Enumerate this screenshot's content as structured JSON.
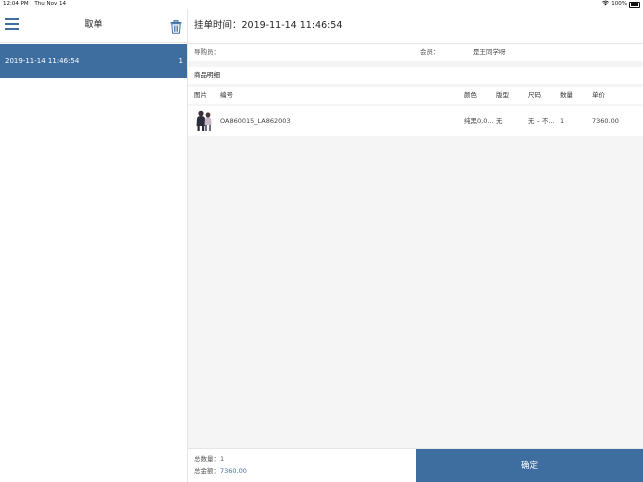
{
  "status_bar": {
    "time": "12:04 PM",
    "date": "Thu Nov 14",
    "battery": "100%"
  },
  "left_panel": {
    "title": "取单",
    "orders": [
      {
        "time": "2019-11-14 11:46:54",
        "count": "1"
      }
    ]
  },
  "detail": {
    "title": "挂单时间：2019-11-14 11:46:54",
    "guide_label": "导购员：",
    "guide_value": "",
    "member_label": "会员：",
    "member_value": "是王同学呀",
    "section_title": "商品明细",
    "columns": {
      "image": "图片",
      "code": "编号",
      "color": "颜色",
      "style": "版型",
      "size": "尺码",
      "qty": "数量",
      "price": "单价"
    },
    "items": [
      {
        "code": "OA860015_LA862003",
        "color": "纯黑0,0...",
        "style": "无",
        "size": "无 – 不...",
        "qty": "1",
        "price": "7360.00"
      }
    ]
  },
  "footer": {
    "total_qty_label": "总数量：",
    "total_qty": "1",
    "total_amount_label": "总金额：",
    "total_amount": "7360.00",
    "confirm_label": "确定"
  },
  "colors": {
    "accent": "#3e6e9f",
    "background": "#f5f5f5"
  },
  "icons": {
    "menu": "hamburger-menu-icon",
    "trash": "trash-icon",
    "wifi": "wifi-icon",
    "battery": "battery-icon"
  }
}
